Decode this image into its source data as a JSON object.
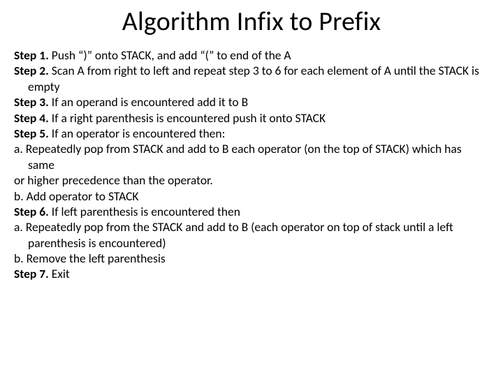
{
  "title": "Algorithm Infix to Prefix",
  "lines": [
    {
      "label": "Step 1.",
      "text": " Push “)” onto STACK, and add “(” to end of the A"
    },
    {
      "label": "Step 2.",
      "text": " Scan A from right to left and repeat step 3 to 6 for each element of A until the STACK is empty"
    },
    {
      "label": "Step 3.",
      "text": " If an operand is encountered add it to B"
    },
    {
      "label": "Step 4.",
      "text": " If a right parenthesis is encountered push it onto STACK"
    },
    {
      "label": "Step 5.",
      "text": " If an operator is encountered then:"
    },
    {
      "label": "",
      "text": "a. Repeatedly pop from STACK and add to B each operator (on the top of STACK) which has same"
    },
    {
      "label": "",
      "text": "or higher precedence than the operator."
    },
    {
      "label": "",
      "text": "b. Add operator to STACK"
    },
    {
      "label": "Step 6.",
      "text": " If left parenthesis is encountered then"
    },
    {
      "label": "",
      "text": "a. Repeatedly pop from the STACK and add to B (each operator on top of stack until a left parenthesis is encountered)"
    },
    {
      "label": "",
      "text": "b. Remove the left parenthesis"
    },
    {
      "label": "Step 7.",
      "text": " Exit"
    }
  ]
}
